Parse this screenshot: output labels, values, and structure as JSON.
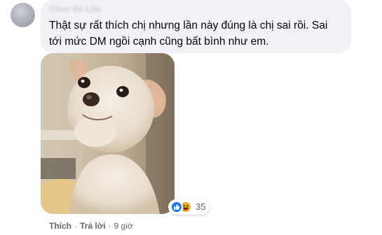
{
  "comment": {
    "author_name": "Chuc Bé Lão",
    "text": "Thật sự rất thích chị nhưng lần này đúng là chị sai rồi. Sai\ntới mức DM ngồi cạnh cũng bất bình như em.",
    "reactions": {
      "icons": [
        "like-icon",
        "haha-icon"
      ],
      "count": "35"
    },
    "actions": {
      "like_label": "Thích",
      "separator": "·",
      "reply_label": "Trả lời",
      "time": "9 giờ"
    }
  },
  "colors": {
    "bubble_bg": "#f0f2f5",
    "text": "#050505",
    "meta_text": "#65676b",
    "like_blue": "#1877f2",
    "haha_yellow": "#f7b125"
  }
}
